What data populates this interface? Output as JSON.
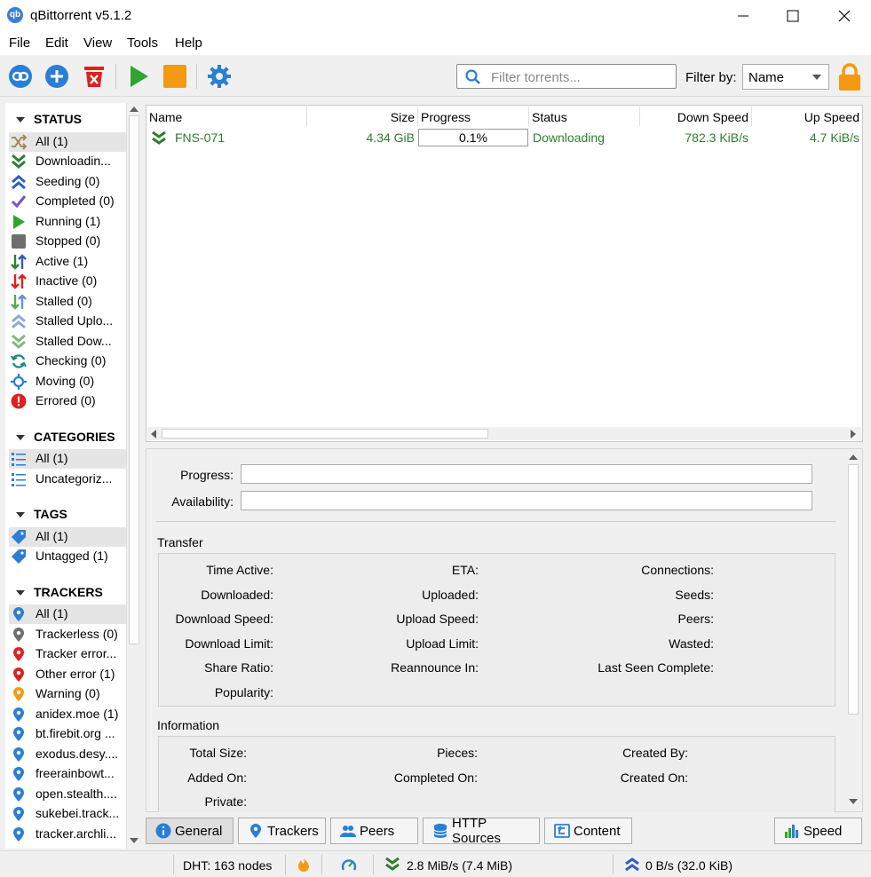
{
  "window": {
    "title": "qBittorrent v5.1.2",
    "app_icon_text": "qb"
  },
  "menu": [
    "File",
    "Edit",
    "View",
    "Tools",
    "Help"
  ],
  "toolbar": {
    "buttons": [
      "add-link-icon",
      "add-torrent-icon",
      "remove-torrent-icon",
      "start-icon",
      "stop-icon",
      "options-icon"
    ],
    "filter_placeholder": "Filter torrents...",
    "filter_by_label": "Filter by:",
    "filter_by_value": "Name"
  },
  "sidebar": {
    "status": {
      "heading": "STATUS",
      "items": [
        {
          "label": "All (1)",
          "icon": "shuffle-icon",
          "selected": true
        },
        {
          "label": "Downloadin...",
          "icon": "download-chevrons-icon"
        },
        {
          "label": "Seeding (0)",
          "icon": "upload-chevrons-icon"
        },
        {
          "label": "Completed (0)",
          "icon": "checkmark-icon"
        },
        {
          "label": "Running (1)",
          "icon": "play-icon"
        },
        {
          "label": "Stopped (0)",
          "icon": "stop-square-icon"
        },
        {
          "label": "Active (1)",
          "icon": "active-arrows-icon"
        },
        {
          "label": "Inactive (0)",
          "icon": "inactive-arrows-icon"
        },
        {
          "label": "Stalled (0)",
          "icon": "stalled-arrows-icon"
        },
        {
          "label": "Stalled Uplo...",
          "icon": "stalled-upload-icon"
        },
        {
          "label": "Stalled Dow...",
          "icon": "stalled-download-icon"
        },
        {
          "label": "Checking (0)",
          "icon": "checking-icon"
        },
        {
          "label": "Moving (0)",
          "icon": "moving-icon"
        },
        {
          "label": "Errored (0)",
          "icon": "error-icon"
        }
      ]
    },
    "categories": {
      "heading": "CATEGORIES",
      "items": [
        {
          "label": "All (1)",
          "icon": "list-icon",
          "selected": true
        },
        {
          "label": "Uncategoriz...",
          "icon": "list-icon"
        }
      ]
    },
    "tags": {
      "heading": "TAGS",
      "items": [
        {
          "label": "All (1)",
          "icon": "tag-icon",
          "selected": true
        },
        {
          "label": "Untagged (1)",
          "icon": "tag-icon"
        }
      ]
    },
    "trackers": {
      "heading": "TRACKERS",
      "items": [
        {
          "label": "All (1)",
          "icon": "pin-blue-icon",
          "selected": true
        },
        {
          "label": "Trackerless (0)",
          "icon": "pin-gray-icon"
        },
        {
          "label": "Tracker error...",
          "icon": "pin-red-icon"
        },
        {
          "label": "Other error (1)",
          "icon": "pin-red-icon"
        },
        {
          "label": "Warning (0)",
          "icon": "pin-orange-icon"
        },
        {
          "label": "anidex.moe (1)",
          "icon": "pin-blue-icon"
        },
        {
          "label": "bt.firebit.org ...",
          "icon": "pin-blue-icon"
        },
        {
          "label": "exodus.desy....",
          "icon": "pin-blue-icon"
        },
        {
          "label": "freerainbowt...",
          "icon": "pin-blue-icon"
        },
        {
          "label": "open.stealth....",
          "icon": "pin-blue-icon"
        },
        {
          "label": "sukebei.track...",
          "icon": "pin-blue-icon"
        },
        {
          "label": "tracker.archli...",
          "icon": "pin-blue-icon"
        }
      ]
    }
  },
  "torrent_list": {
    "columns": [
      "Name",
      "Size",
      "Progress",
      "Status",
      "Down Speed",
      "Up Speed"
    ],
    "rows": [
      {
        "name": "FNS-071",
        "size": "4.34 GiB",
        "progress": "0.1%",
        "status": "Downloading",
        "down_speed": "782.3 KiB/s",
        "up_speed": "4.7 KiB/s"
      }
    ]
  },
  "properties": {
    "progress_label": "Progress:",
    "availability_label": "Availability:",
    "transfer": {
      "title": "Transfer",
      "col1": [
        "Time Active:",
        "Downloaded:",
        "Download Speed:",
        "Download Limit:",
        "Share Ratio:",
        "Popularity:"
      ],
      "col2": [
        "ETA:",
        "Uploaded:",
        "Upload Speed:",
        "Upload Limit:",
        "Reannounce In:"
      ],
      "col3": [
        "Connections:",
        "Seeds:",
        "Peers:",
        "Wasted:",
        "Last Seen Complete:"
      ]
    },
    "information": {
      "title": "Information",
      "col1": [
        "Total Size:",
        "Added On:",
        "Private:"
      ],
      "col2": [
        "Pieces:",
        "Completed On:"
      ],
      "col3": [
        "Created By:",
        "Created On:"
      ]
    }
  },
  "bottom_tabs": [
    "General",
    "Trackers",
    "Peers",
    "HTTP Sources",
    "Content"
  ],
  "speed_button": "Speed",
  "statusbar": {
    "dht": "DHT: 163 nodes",
    "download": "2.8 MiB/s (7.4 MiB)",
    "upload": "0 B/s (32.0 KiB)"
  },
  "colors": {
    "download_green": "#2f7d32",
    "accent_blue": "#2a7fd4",
    "error_red": "#e02020",
    "stop_orange": "#f39a12"
  }
}
